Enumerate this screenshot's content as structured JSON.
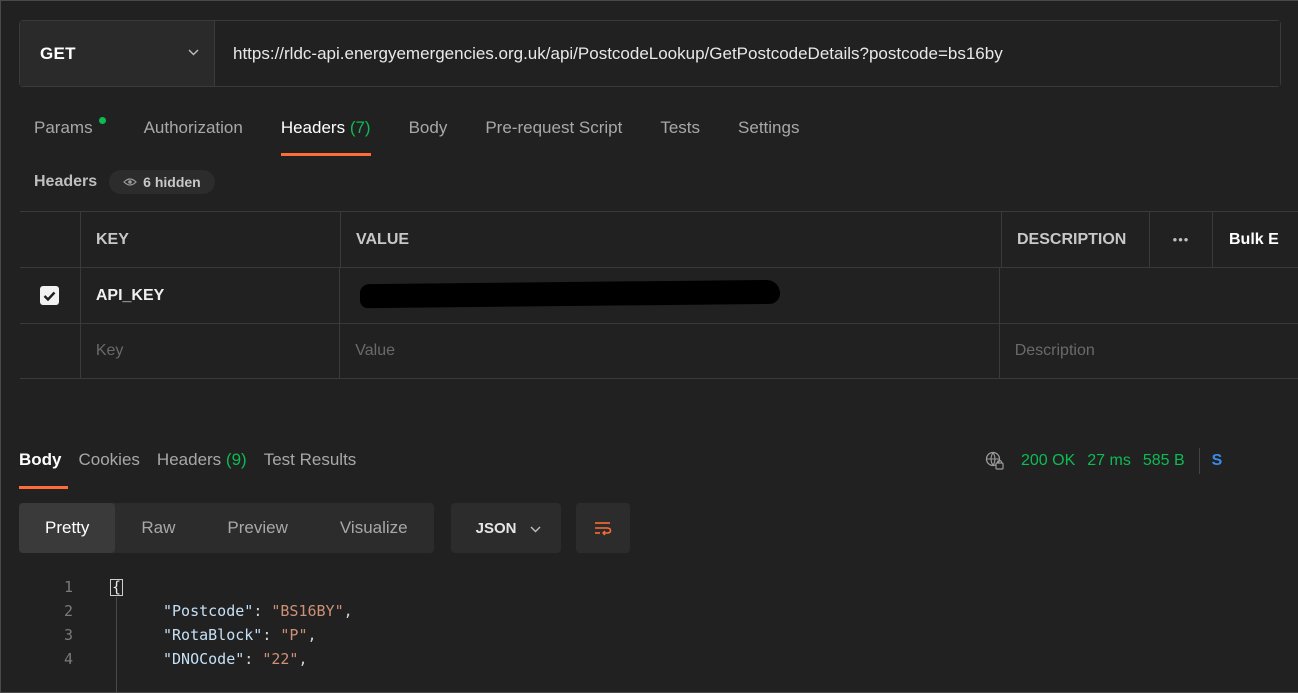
{
  "request": {
    "method": "GET",
    "url": "https://rldc-api.energyemergencies.org.uk/api/PostcodeLookup/GetPostcodeDetails?postcode=bs16by"
  },
  "request_tabs": {
    "params": "Params",
    "authorization": "Authorization",
    "headers": "Headers",
    "headers_count": "(7)",
    "body": "Body",
    "prerequest": "Pre-request Script",
    "tests": "Tests",
    "settings": "Settings"
  },
  "headers_section": {
    "label": "Headers",
    "hidden": "6 hidden"
  },
  "headers_table": {
    "col_key": "KEY",
    "col_value": "VALUE",
    "col_description": "DESCRIPTION",
    "more": "•••",
    "bulk_edit": "Bulk E",
    "rows": [
      {
        "key": "API_KEY",
        "value": "",
        "checked": true
      }
    ],
    "placeholder_key": "Key",
    "placeholder_value": "Value",
    "placeholder_description": "Description"
  },
  "response_tabs": {
    "body": "Body",
    "cookies": "Cookies",
    "headers": "Headers",
    "headers_count": "(9)",
    "test_results": "Test Results"
  },
  "response_status": {
    "status": "200 OK",
    "time": "27 ms",
    "size": "585 B",
    "save": "S"
  },
  "view_modes": {
    "pretty": "Pretty",
    "raw": "Raw",
    "preview": "Preview",
    "visualize": "Visualize",
    "format": "JSON"
  },
  "code_lines": {
    "n1": "1",
    "n2": "2",
    "n3": "3",
    "n4": "4",
    "open": "{",
    "k1": "\"Postcode\"",
    "v1": "\"BS16BY\"",
    "k2": "\"RotaBlock\"",
    "v2": "\"P\"",
    "k3": "\"DNOCode\"",
    "v3": "\"22\""
  },
  "colors": {
    "accent": "#ff6c37",
    "success": "#0cbb52",
    "link": "#3a8be8",
    "background": "#212121"
  }
}
